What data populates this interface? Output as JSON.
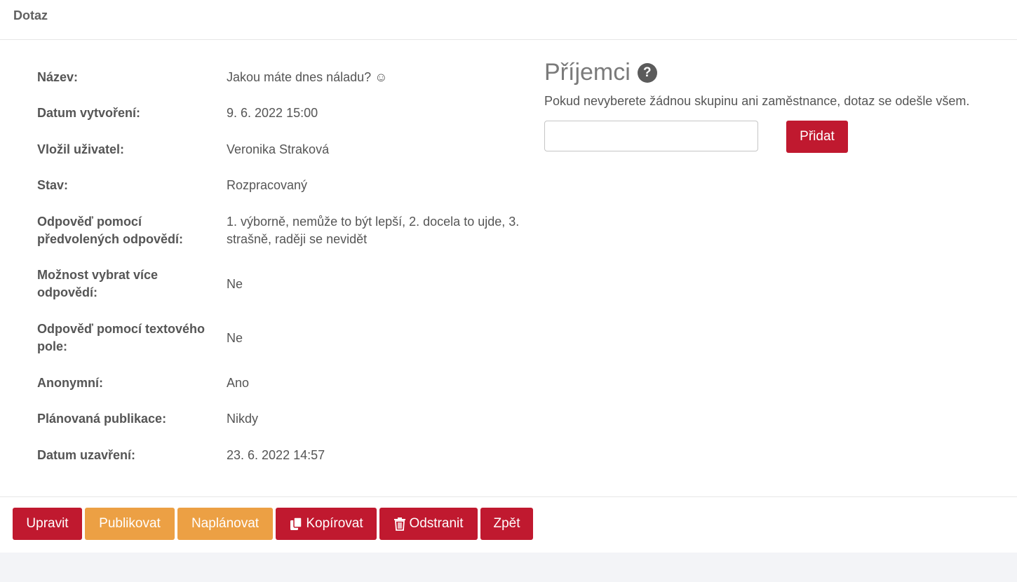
{
  "header": {
    "title": "Dotaz"
  },
  "details": [
    {
      "label": "Název:",
      "value": "Jakou máte dnes náladu? ☺"
    },
    {
      "label": "Datum vytvoření:",
      "value": "9. 6. 2022 15:00"
    },
    {
      "label": "Vložil uživatel:",
      "value": "Veronika Straková"
    },
    {
      "label": "Stav:",
      "value": "Rozpracovaný"
    },
    {
      "label": "Odpověď pomocí předvolených odpovědí:",
      "value": "1. výborně, nemůže to být lepší, 2. docela to ujde, 3. strašně, raději se nevidět"
    },
    {
      "label": "Možnost vybrat více odpovědí:",
      "value": "Ne"
    },
    {
      "label": "Odpověď pomocí textového pole:",
      "value": "Ne"
    },
    {
      "label": "Anonymní:",
      "value": "Ano"
    },
    {
      "label": "Plánovaná publikace:",
      "value": "Nikdy"
    },
    {
      "label": "Datum uzavření:",
      "value": "23. 6. 2022 14:57"
    }
  ],
  "recipients": {
    "title": "Příjemci",
    "help_icon": "question-circle-icon",
    "help_glyph": "?",
    "description": "Pokud nevyberete žádnou skupinu ani zaměstnance, dotaz se odešle všem.",
    "input_value": "",
    "add_label": "Přidat"
  },
  "actions": {
    "edit": "Upravit",
    "publish": "Publikovat",
    "schedule": "Naplánovat",
    "copy": "Kopírovat",
    "copy_icon": "copy-icon",
    "delete": "Odstranit",
    "delete_icon": "trash-icon",
    "back": "Zpět"
  },
  "colors": {
    "primary": "#c0192f",
    "warning": "#eca044",
    "page_bg": "#f3f4f7"
  }
}
